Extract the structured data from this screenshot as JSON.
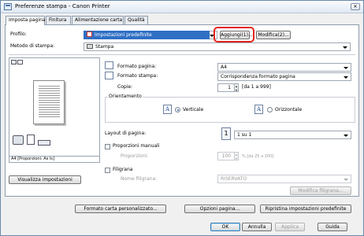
{
  "window": {
    "title": "Preferenze stampa - Canon Printer"
  },
  "tabs": [
    {
      "label": "Imposta pagina"
    },
    {
      "label": "Finitura"
    },
    {
      "label": "Alimentazione carta"
    },
    {
      "label": "Qualità"
    }
  ],
  "profile": {
    "label": "Profilo:",
    "value": "Impostazioni predefinite",
    "add_label": "Aggiungi(1)...",
    "edit_label": "Modifica(2)..."
  },
  "output_method": {
    "label": "Metodo di stampa:",
    "value": "Stampa"
  },
  "preview": {
    "caption": "A4 [Proporzioni: As Is]",
    "view_settings_label": "Visualizza impostazioni"
  },
  "page_size": {
    "label": "Formato pagina:",
    "value": "A4"
  },
  "output_size": {
    "label": "Formato stampa:",
    "value": "Corrispondenza formato pagina"
  },
  "copies": {
    "label": "Copie:",
    "value": "1",
    "range": "[da 1 a 999]"
  },
  "orientation": {
    "label": "Orientamento",
    "portrait_label": "Verticale",
    "landscape_label": "Orizzontale",
    "selected": "portrait"
  },
  "layout": {
    "label": "Layout di pagina:",
    "icon_text": "1",
    "value": "1 su 1"
  },
  "manual_scaling": {
    "label": "Proporzioni manuali",
    "scaling_label": "Proporzioni:",
    "scaling_value": "100",
    "scaling_range": "% [da 25 a 200]"
  },
  "watermark": {
    "label": "Filigrana",
    "name_label": "Nome filigrana:",
    "name_value": "RISERVATO",
    "edit_label": "Modifica filigrana..."
  },
  "bottom": {
    "custom_paper_label": "Formato carta personalizzato...",
    "page_options_label": "Opzioni pagina...",
    "restore_label": "Ripristina impostazioni predefinite"
  },
  "dialog": {
    "ok_label": "OK",
    "cancel_label": "Annulla",
    "apply_label": "Applica",
    "help_label": "Guida"
  },
  "titlebar_buttons": {
    "close_glyph": "✕"
  }
}
